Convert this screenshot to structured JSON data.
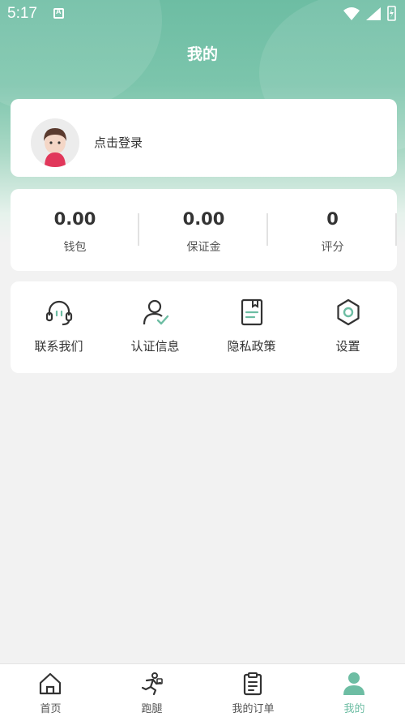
{
  "status_bar": {
    "time": "5:17"
  },
  "header": {
    "title": "我的"
  },
  "login_card": {
    "prompt": "点击登录"
  },
  "stats": [
    {
      "value": "0.00",
      "label": "钱包"
    },
    {
      "value": "0.00",
      "label": "保证金"
    },
    {
      "value": "0",
      "label": "评分"
    }
  ],
  "menu": [
    {
      "label": "联系我们",
      "icon": "headset-icon"
    },
    {
      "label": "认证信息",
      "icon": "user-verified-icon"
    },
    {
      "label": "隐私政策",
      "icon": "document-icon"
    },
    {
      "label": "设置",
      "icon": "gear-icon"
    }
  ],
  "tabbar": {
    "items": [
      {
        "label": "首页",
        "icon": "home-icon"
      },
      {
        "label": "跑腿",
        "icon": "runner-icon"
      },
      {
        "label": "我的订单",
        "icon": "clipboard-icon"
      },
      {
        "label": "我的",
        "icon": "person-icon"
      }
    ],
    "active_index": 3
  },
  "colors": {
    "accent": "#6dbda3",
    "background": "#f2f2f2",
    "card": "#ffffff",
    "text": "#333333"
  }
}
